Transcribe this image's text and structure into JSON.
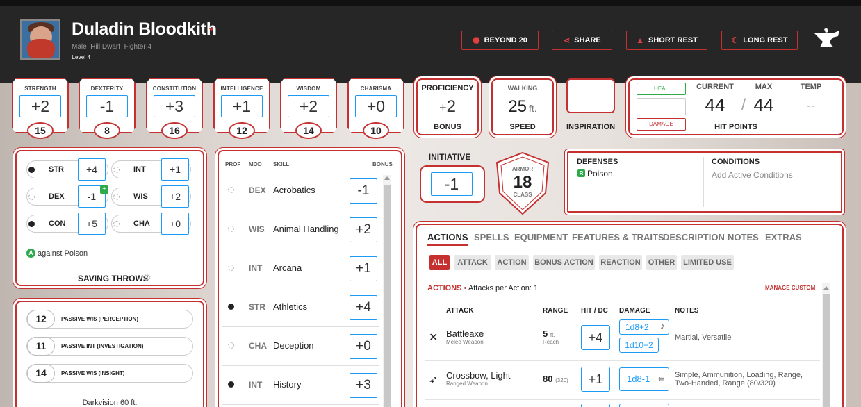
{
  "header": {
    "name": "Duladin Bloodkith",
    "subtitle": "Male  Hill Dwarf  Fighter 4",
    "level": "Level 4",
    "buttons": {
      "beyond20": "BEYOND 20",
      "share": "SHARE",
      "short_rest": "SHORT REST",
      "long_rest": "LONG REST"
    }
  },
  "abilities": [
    {
      "name": "STRENGTH",
      "mod": "+2",
      "score": "15"
    },
    {
      "name": "DEXTERITY",
      "mod": "-1",
      "score": "8"
    },
    {
      "name": "CONSTITUTION",
      "mod": "+3",
      "score": "16"
    },
    {
      "name": "INTELLIGENCE",
      "mod": "+1",
      "score": "12"
    },
    {
      "name": "WISDOM",
      "mod": "+2",
      "score": "14"
    },
    {
      "name": "CHARISMA",
      "mod": "+0",
      "score": "10"
    }
  ],
  "proficiency": {
    "label": "PROFICIENCY",
    "sign": "+",
    "value": "2",
    "sublabel": "BONUS"
  },
  "speed": {
    "label": "WALKING",
    "value": "25",
    "unit": "ft.",
    "sublabel": "SPEED"
  },
  "inspiration": {
    "label": "INSPIRATION"
  },
  "hp": {
    "heal": "HEAL",
    "damage": "DAMAGE",
    "current_label": "CURRENT",
    "max_label": "MAX",
    "temp_label": "TEMP",
    "current": "44",
    "max": "44",
    "temp": "--",
    "footer": "HIT POINTS"
  },
  "saving_throws": {
    "items": [
      {
        "name": "STR",
        "value": "+4",
        "prof": true
      },
      {
        "name": "INT",
        "value": "+1",
        "prof": false
      },
      {
        "name": "DEX",
        "value": "-1",
        "prof": false
      },
      {
        "name": "WIS",
        "value": "+2",
        "prof": false
      },
      {
        "name": "CON",
        "value": "+5",
        "prof": true
      },
      {
        "name": "CHA",
        "value": "+0",
        "prof": false
      }
    ],
    "advantage_badge": "A",
    "note": "against Poison",
    "title": "SAVING THROWS"
  },
  "senses": {
    "items": [
      {
        "value": "12",
        "label": "PASSIVE WIS (PERCEPTION)"
      },
      {
        "value": "11",
        "label": "PASSIVE INT (INVESTIGATION)"
      },
      {
        "value": "14",
        "label": "PASSIVE WIS (INSIGHT)"
      }
    ],
    "darkvision": "Darkvision 60 ft."
  },
  "skills": {
    "headers": {
      "prof": "PROF",
      "mod": "MOD",
      "skill": "SKILL",
      "bonus": "BONUS"
    },
    "items": [
      {
        "mod": "DEX",
        "name": "Acrobatics",
        "value": "-1",
        "prof": false
      },
      {
        "mod": "WIS",
        "name": "Animal Handling",
        "value": "+2",
        "prof": false
      },
      {
        "mod": "INT",
        "name": "Arcana",
        "value": "+1",
        "prof": false
      },
      {
        "mod": "STR",
        "name": "Athletics",
        "value": "+4",
        "prof": true
      },
      {
        "mod": "CHA",
        "name": "Deception",
        "value": "+0",
        "prof": false
      },
      {
        "mod": "INT",
        "name": "History",
        "value": "+3",
        "prof": true
      }
    ]
  },
  "initiative": {
    "label": "INITIATIVE",
    "value": "-1"
  },
  "armor": {
    "top": "ARMOR",
    "value": "18",
    "bottom": "CLASS"
  },
  "defenses": {
    "title": "DEFENSES",
    "badge": "R",
    "item": "Poison"
  },
  "conditions": {
    "title": "CONDITIONS",
    "placeholder": "Add Active Conditions"
  },
  "actions": {
    "tabs": [
      "ACTIONS",
      "SPELLS",
      "EQUIPMENT",
      "FEATURES & TRAITS",
      "DESCRIPTION",
      "NOTES",
      "EXTRAS"
    ],
    "filters": [
      "ALL",
      "ATTACK",
      "ACTION",
      "BONUS ACTION",
      "REACTION",
      "OTHER",
      "LIMITED USE"
    ],
    "section_title": "ACTIONS",
    "section_sep": "•",
    "attacks_per_action": "Attacks per Action: 1",
    "manage_custom": "MANAGE CUSTOM",
    "columns": {
      "attack": "ATTACK",
      "range": "RANGE",
      "hit": "HIT / DC",
      "damage": "DAMAGE",
      "notes": "NOTES"
    },
    "rows": [
      {
        "name": "Battleaxe",
        "type": "Melee Weapon",
        "range": "5",
        "range_unit": "ft.",
        "range_sub": "Reach",
        "hit": "+4",
        "damage": "1d8+2",
        "damage2": "1d10+2",
        "notes": "Martial, Versatile"
      },
      {
        "name": "Crossbow, Light",
        "type": "Ranged Weapon",
        "range": "80",
        "range_long": "(320)",
        "hit": "+1",
        "damage": "1d8-1",
        "notes": "Simple, Ammunition, Loading, Range, Two-Handed, Range (80/320)"
      }
    ]
  }
}
